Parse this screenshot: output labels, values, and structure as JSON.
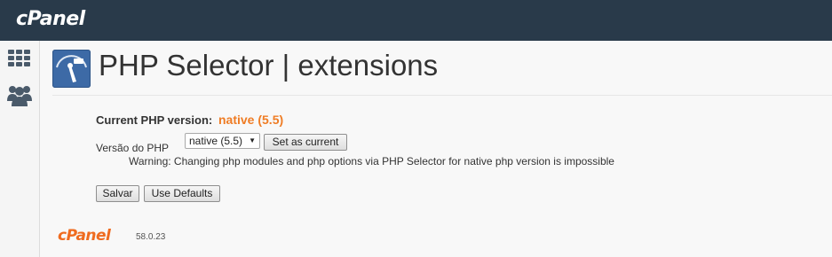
{
  "brand": {
    "logo_text": "cPanel",
    "footer_logo_text": "cPanel",
    "version": "58.0.23"
  },
  "sidebar": {
    "items": [
      {
        "icon": "grid-icon"
      },
      {
        "icon": "users-icon"
      }
    ]
  },
  "page": {
    "title": "PHP Selector | extensions",
    "app_icon": "php-selector-icon",
    "current_version_label": "Current PHP version:",
    "current_version_value": "native (5.5)",
    "version_select_label": "Versão do PHP",
    "version_select_value": "native (5.5)",
    "set_current_button": "Set as current",
    "warning": "Warning: Changing php modules and php options via PHP Selector for native php version is impossible",
    "save_button": "Salvar",
    "defaults_button": "Use Defaults"
  },
  "colors": {
    "topbar": "#293a4a",
    "accent": "#ef7c24"
  }
}
